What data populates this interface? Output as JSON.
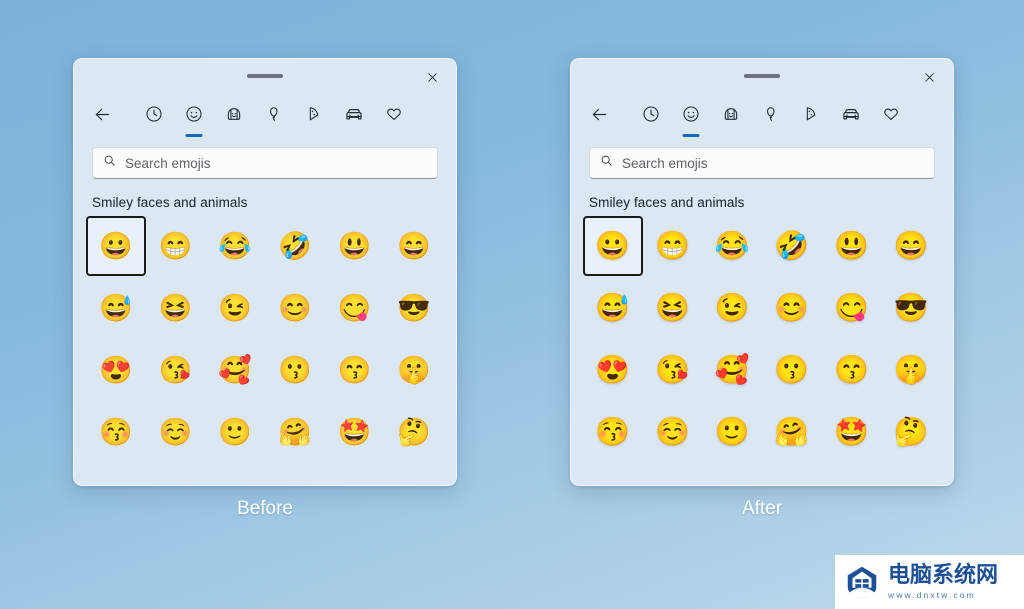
{
  "scene": {
    "background_color": "#86b9de",
    "caption_color": "#ffffff"
  },
  "panels": [
    {
      "id": "before",
      "caption": "Before",
      "titlebar": {
        "drag_handle_name": "drag-handle",
        "close_label": "Close"
      },
      "tabs": [
        {
          "name": "back-arrow-icon",
          "icon": "arrow-left",
          "selected": false,
          "label": "Back"
        },
        {
          "name": "recent-icon",
          "icon": "clock",
          "selected": false,
          "label": "Recently used"
        },
        {
          "name": "smiley-icon",
          "icon": "smiley",
          "selected": true,
          "label": "Smiley faces and animals"
        },
        {
          "name": "people-icon",
          "icon": "people",
          "selected": false,
          "label": "People"
        },
        {
          "name": "celebration-icon",
          "icon": "balloon",
          "selected": false,
          "label": "Celebration and objects"
        },
        {
          "name": "food-icon",
          "icon": "pizza",
          "selected": false,
          "label": "Food and plants"
        },
        {
          "name": "travel-icon",
          "icon": "car",
          "selected": false,
          "label": "Transportation and places"
        },
        {
          "name": "favorites-icon",
          "icon": "heart",
          "selected": false,
          "label": "Symbols"
        }
      ],
      "search": {
        "placeholder": "Search emojis",
        "value": ""
      },
      "section_title": "Smiley faces and animals",
      "emoji_rows": [
        [
          "😀",
          "😁",
          "😂",
          "🤣",
          "😃",
          "😄"
        ],
        [
          "😅",
          "😆",
          "😉",
          "😊",
          "😋",
          "😎"
        ],
        [
          "😍",
          "😘",
          "🥰",
          "😗",
          "😙",
          "🤫"
        ],
        [
          "😚",
          "☺️",
          "🙂",
          "🤗",
          "🤩",
          "🤔"
        ]
      ],
      "selected_emoji_index": 0
    },
    {
      "id": "after",
      "caption": "After",
      "titlebar": {
        "drag_handle_name": "drag-handle",
        "close_label": "Close"
      },
      "tabs": [
        {
          "name": "back-arrow-icon",
          "icon": "arrow-left",
          "selected": false,
          "label": "Back"
        },
        {
          "name": "recent-icon",
          "icon": "clock",
          "selected": false,
          "label": "Recently used"
        },
        {
          "name": "smiley-icon",
          "icon": "smiley",
          "selected": true,
          "label": "Smiley faces and animals"
        },
        {
          "name": "people-icon",
          "icon": "people",
          "selected": false,
          "label": "People"
        },
        {
          "name": "celebration-icon",
          "icon": "balloon",
          "selected": false,
          "label": "Celebration and objects"
        },
        {
          "name": "food-icon",
          "icon": "pizza",
          "selected": false,
          "label": "Food and plants"
        },
        {
          "name": "travel-icon",
          "icon": "car",
          "selected": false,
          "label": "Transportation and places"
        },
        {
          "name": "favorites-icon",
          "icon": "heart",
          "selected": false,
          "label": "Symbols"
        }
      ],
      "search": {
        "placeholder": "Search emojis",
        "value": ""
      },
      "section_title": "Smiley faces and animals",
      "emoji_rows": [
        [
          "😀",
          "😁",
          "😂",
          "🤣",
          "😃",
          "😄"
        ],
        [
          "😅",
          "😆",
          "😉",
          "😊",
          "😋",
          "😎"
        ],
        [
          "😍",
          "😘",
          "🥰",
          "😗",
          "😙",
          "🤫"
        ],
        [
          "😚",
          "☺️",
          "🙂",
          "🤗",
          "🤩",
          "🤔"
        ]
      ],
      "selected_emoji_index": 0
    }
  ],
  "watermark": {
    "title": "电脑系统网",
    "url": "www.dnxtw.com",
    "brand_color": "#1c4f96"
  }
}
